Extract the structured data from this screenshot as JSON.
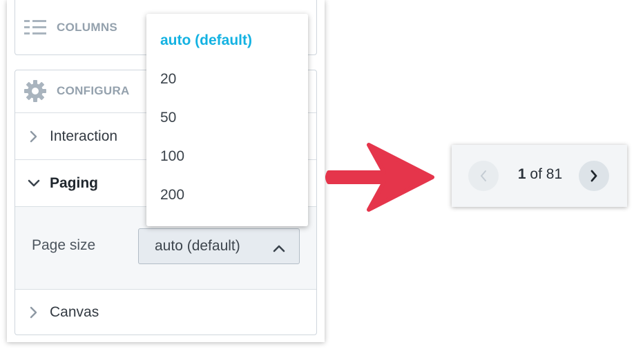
{
  "panel": {
    "columns": {
      "title": "COLUMNS",
      "icon": "columns-icon"
    },
    "configuration": {
      "title": "CONFIGURA",
      "icon": "gear-icon",
      "sections": {
        "interactions": {
          "label": "Interaction",
          "expanded": false
        },
        "paging": {
          "label": "Paging",
          "expanded": true,
          "page_size_label": "Page size",
          "page_size_value": "auto (default)"
        },
        "canvas": {
          "label": "Canvas",
          "expanded": false
        }
      }
    }
  },
  "dropdown": {
    "open": true,
    "options": [
      "auto (default)",
      "20",
      "50",
      "100",
      "200"
    ],
    "selected_index": 0
  },
  "pager": {
    "current": "1",
    "of_text": "of",
    "total": "81"
  },
  "colors": {
    "accent": "#14b2e2",
    "arrow": "#e5354b",
    "muted_header": "#94a1ad",
    "border": "#cfd6dd"
  }
}
